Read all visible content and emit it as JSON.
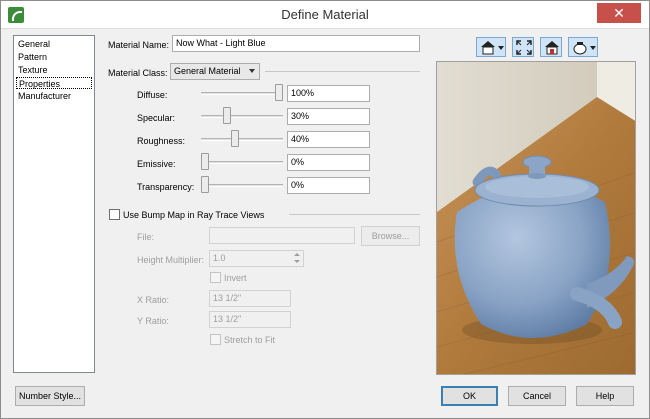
{
  "window": {
    "title": "Define Material",
    "close_glyph": "✕"
  },
  "nav": {
    "items": [
      {
        "label": "General",
        "selected": false
      },
      {
        "label": "Pattern",
        "selected": false
      },
      {
        "label": "Texture",
        "selected": false
      },
      {
        "label": "Properties",
        "selected": true
      },
      {
        "label": "Manufacturer",
        "selected": false
      }
    ]
  },
  "material": {
    "name_label": "Material Name:",
    "name_value": "Now What - Light  Blue",
    "class_label": "Material Class:",
    "class_value": "General Material"
  },
  "properties": [
    {
      "label": "Diffuse:",
      "value": "100%",
      "level": 1.0
    },
    {
      "label": "Specular:",
      "value": "30%",
      "level": 0.3
    },
    {
      "label": "Roughness:",
      "value": "40%",
      "level": 0.4
    },
    {
      "label": "Emissive:",
      "value": "0%",
      "level": 0
    },
    {
      "label": "Transparency:",
      "value": "0%",
      "level": 0
    }
  ],
  "bump": {
    "checkbox_label": "Use Bump Map in Ray Trace Views",
    "file_label": "File:",
    "file_value": "",
    "browse_label": "Browse...",
    "height_multiplier_label": "Height Multiplier:",
    "height_multiplier_value": "1.0",
    "invert_label": "Invert",
    "x_ratio_label": "X Ratio:",
    "x_ratio_value": "13 1/2\"",
    "y_ratio_label": "Y Ratio:",
    "y_ratio_value": "13 1/2\"",
    "stretch_label": "Stretch to Fit"
  },
  "toolbar": {
    "icons": [
      "house-view-icon",
      "fit-window-icon",
      "material-preview-icon",
      "render-options-icon"
    ]
  },
  "buttons": {
    "number_style": "Number Style...",
    "ok": "OK",
    "cancel": "Cancel",
    "help": "Help"
  },
  "colors": {
    "teapot": "#8fa9c9",
    "floor": "#b5813f",
    "wall": "#d6d0c2",
    "accent": "#3c7fb1"
  }
}
